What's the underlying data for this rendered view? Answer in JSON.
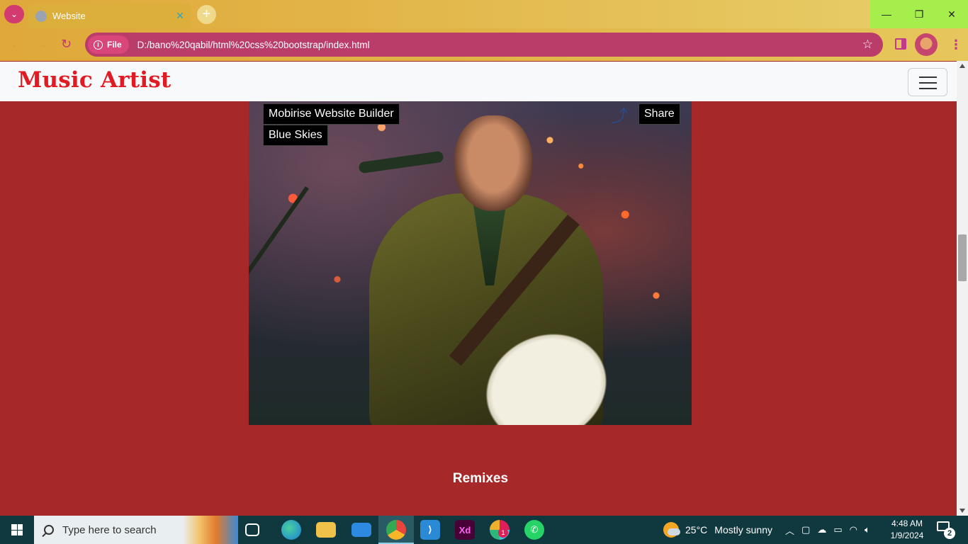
{
  "browser": {
    "tab": {
      "title": "Website",
      "close_glyph": "✕"
    },
    "new_tab_glyph": "+",
    "window_controls": {
      "minimize": "—",
      "restore": "❐",
      "close": "✕"
    },
    "chip_label": "File",
    "url": "D:/bano%20qabil/html%20css%20bootstrap/index.html",
    "icons": [
      "tab-search-icon",
      "globe-icon",
      "back-arrow-icon",
      "forward-arrow-icon",
      "reload-icon",
      "info-icon",
      "star-icon",
      "side-panel-icon",
      "kebab-menu-icon"
    ]
  },
  "page": {
    "brand": "Music Artist",
    "brand_color": "#e01b24",
    "background_color": "#a72828",
    "hero": {
      "caption_1": "Mobirise Website Builder",
      "caption_2": "Blue Skies",
      "share_label": "Share"
    },
    "section_title": "Remixes"
  },
  "taskbar": {
    "search_placeholder": "Type here to search",
    "pinned_apps": [
      "task-view-icon",
      "edge-icon",
      "file-explorer-icon",
      "mail-icon",
      "chrome-icon",
      "vscode-icon",
      "adobe-xd-icon",
      "slack-icon",
      "whatsapp-icon"
    ],
    "xd_label": "Xd",
    "slack_badge": "1",
    "weather": {
      "temp": "25°C",
      "condition": "Mostly sunny"
    },
    "clock": {
      "time": "4:48 AM",
      "date": "1/9/2024"
    },
    "notification_count": "2"
  }
}
